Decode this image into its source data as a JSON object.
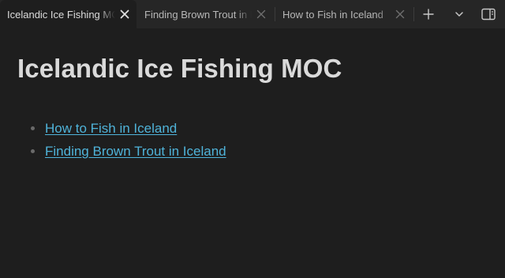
{
  "tabs": [
    {
      "label": "Icelandic Ice Fishing MOC",
      "active": true
    },
    {
      "label": "Finding Brown Trout in Iceland",
      "active": false
    },
    {
      "label": "How to Fish in Iceland",
      "active": false
    }
  ],
  "tab_actions": {
    "new_tab_icon": "plus-icon",
    "tab_list_icon": "chevron-down-icon",
    "sidebar_toggle_icon": "sidebar-right-icon"
  },
  "note": {
    "title": "Icelandic Ice Fishing MOC",
    "links": [
      {
        "label": "How to Fish in Iceland"
      },
      {
        "label": "Finding Brown Trout in Iceland"
      }
    ]
  },
  "colors": {
    "background": "#1e1e1e",
    "tabbar": "#262626",
    "link": "#4fb3d9",
    "title": "#dadada"
  }
}
